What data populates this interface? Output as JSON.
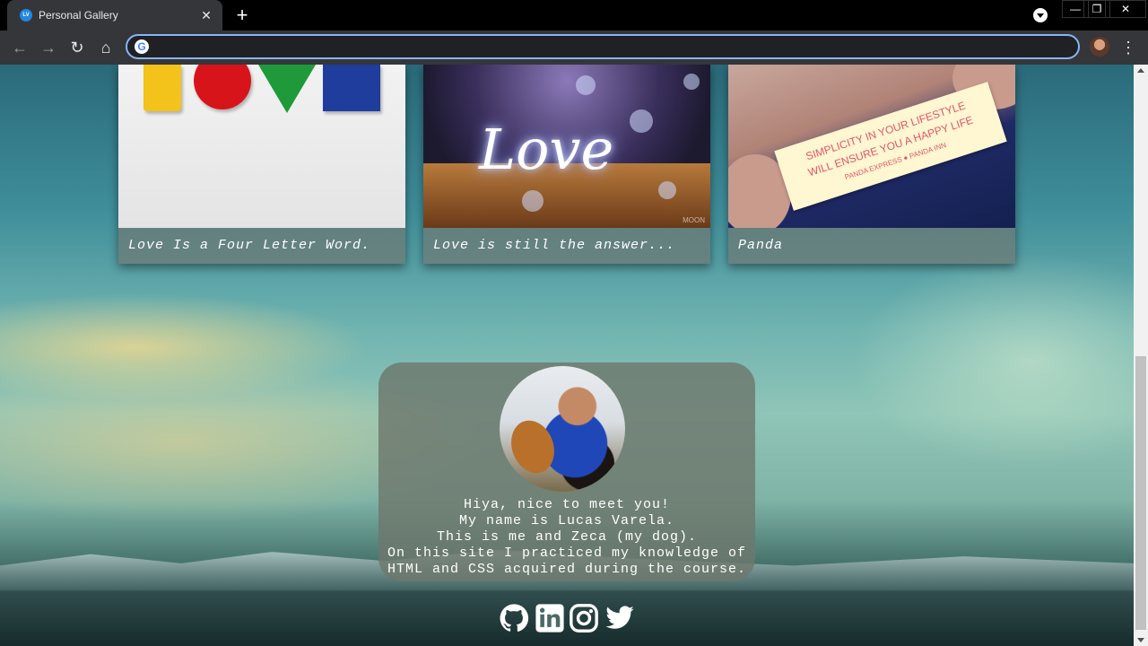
{
  "browser": {
    "tab_title": "Personal Gallery",
    "tab_favicon": "LV",
    "close_glyph": "✕",
    "new_tab_glyph": "+",
    "address_value": "",
    "window_controls": {
      "minimize": "—",
      "maximize": "❐",
      "close": "✕"
    },
    "nav": {
      "back": "←",
      "forward": "→",
      "reload": "↻",
      "home": "⌂",
      "menu": "⋮"
    },
    "google_glyph": "G"
  },
  "gallery": {
    "cards": [
      {
        "caption": "Love Is a Four Letter Word."
      },
      {
        "caption": "Love is still the answer...",
        "art_text": "Love",
        "signature": "MOON"
      },
      {
        "caption": "Panda",
        "fortune_lines": [
          "SIMPLICITY IN YOUR LIFESTYLE",
          "WILL ENSURE YOU A HAPPY LIFE",
          "PANDA EXPRESS ● PANDA INN"
        ]
      }
    ]
  },
  "about": {
    "lines": [
      "Hiya, nice to meet you!",
      "My name is Lucas Varela.",
      "This is me and Zeca (my dog).",
      "On this site I practiced my knowledge of",
      "HTML and CSS acquired during the course."
    ]
  },
  "footer": {
    "links": [
      {
        "icon": "github-icon"
      },
      {
        "icon": "linkedin-icon"
      },
      {
        "icon": "instagram-icon"
      },
      {
        "icon": "twitter-icon"
      }
    ]
  }
}
